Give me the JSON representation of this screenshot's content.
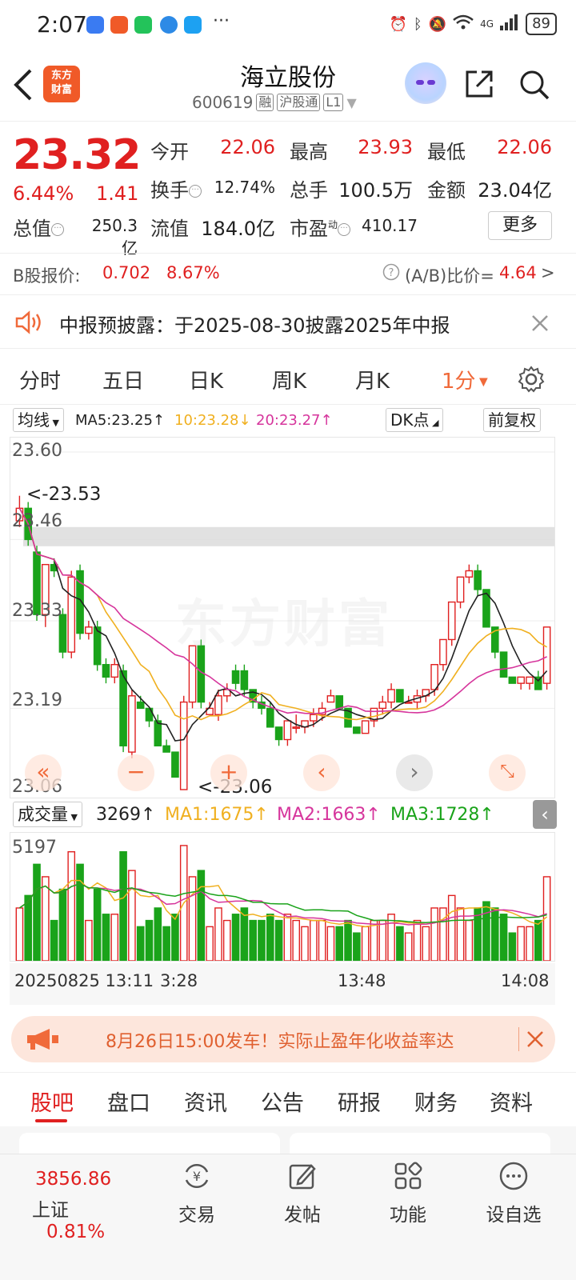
{
  "status_bar": {
    "time": "2:07",
    "more": "···",
    "network": "4G",
    "battery": "89"
  },
  "header": {
    "title": "海立股份",
    "code": "600619",
    "tag_margin": "融",
    "tag_connect": "沪股通",
    "tag_level": "L1",
    "logo_line1": "东方",
    "logo_line2": "财富"
  },
  "quote": {
    "price": "23.32",
    "change_pct": "6.44%",
    "change": "1.41",
    "open_label": "今开",
    "open": "22.06",
    "high_label": "最高",
    "high": "23.93",
    "low_label": "最低",
    "low": "22.06",
    "turnover_label": "换手",
    "turnover": "12.74%",
    "volume_label": "总手",
    "volume": "100.5万",
    "amount_label": "金额",
    "amount": "23.04亿",
    "mcap_label": "总值",
    "mcap": "250.3亿",
    "float_label": "流值",
    "float": "184.0亿",
    "pe_label": "市盈",
    "pe_sup": "动",
    "pe": "410.17",
    "more_button": "更多"
  },
  "b_share": {
    "label": "B股报价:",
    "price": "0.702",
    "pct": "8.67%",
    "ratio_label": "(A/B)比价=",
    "ratio": "4.64",
    "arrow": ">"
  },
  "notice": {
    "text": "中报预披露：于2025-08-30披露2025年中报"
  },
  "tabs": [
    "分时",
    "五日",
    "日K",
    "周K",
    "月K",
    "1分"
  ],
  "ma_legend": {
    "selector": "均线",
    "ma5": "MA5:23.25↑",
    "ma10": "10:23.28↓",
    "ma20": "20:23.27↑",
    "dk": "DK点",
    "fq": "前复权"
  },
  "chart_data": {
    "type": "candlestick",
    "interval": "1分",
    "y_ticks": [
      "23.60",
      "23.46",
      "23.33",
      "23.19",
      "23.06"
    ],
    "ylim": [
      23.06,
      23.6
    ],
    "max_annotation": "<-23.53",
    "min_annotation": "<-23.06",
    "watermark": "东方财富",
    "x_labels": [
      "20250825 13:11",
      "3:28",
      "13:48",
      "14:08"
    ],
    "candles": [
      [
        23.49,
        23.53,
        23.48,
        23.51
      ],
      [
        23.51,
        23.52,
        23.45,
        23.46
      ],
      [
        23.44,
        23.45,
        23.33,
        23.34
      ],
      [
        23.34,
        23.42,
        23.32,
        23.42
      ],
      [
        23.42,
        23.43,
        23.4,
        23.41
      ],
      [
        23.34,
        23.35,
        23.27,
        23.28
      ],
      [
        23.28,
        23.41,
        23.27,
        23.4
      ],
      [
        23.41,
        23.42,
        23.3,
        23.31
      ],
      [
        23.31,
        23.33,
        23.3,
        23.32
      ],
      [
        23.32,
        23.33,
        23.25,
        23.26
      ],
      [
        23.26,
        23.27,
        23.23,
        23.24
      ],
      [
        23.24,
        23.27,
        23.23,
        23.26
      ],
      [
        23.25,
        23.26,
        23.12,
        23.13
      ],
      [
        23.12,
        23.22,
        23.11,
        23.21
      ],
      [
        23.2,
        23.21,
        23.19,
        23.19
      ],
      [
        23.19,
        23.19,
        23.16,
        23.17
      ],
      [
        23.17,
        23.18,
        23.13,
        23.13
      ],
      [
        23.13,
        23.14,
        23.12,
        23.12
      ],
      [
        23.12,
        23.12,
        23.08,
        23.08
      ],
      [
        23.06,
        23.21,
        23.06,
        23.2
      ],
      [
        23.2,
        23.29,
        23.19,
        23.29
      ],
      [
        23.29,
        23.3,
        23.19,
        23.2
      ],
      [
        23.18,
        23.2,
        23.18,
        23.19
      ],
      [
        23.18,
        23.22,
        23.17,
        23.21
      ],
      [
        23.21,
        23.23,
        23.2,
        23.22
      ],
      [
        23.25,
        23.26,
        23.22,
        23.23
      ],
      [
        23.25,
        23.26,
        23.21,
        23.22
      ],
      [
        23.22,
        23.22,
        23.19,
        23.2
      ],
      [
        23.2,
        23.21,
        23.18,
        23.19
      ],
      [
        23.19,
        23.2,
        23.16,
        23.16
      ],
      [
        23.16,
        23.16,
        23.13,
        23.14
      ],
      [
        23.14,
        23.17,
        23.13,
        23.17
      ],
      [
        23.16,
        23.18,
        23.15,
        23.16
      ],
      [
        23.16,
        23.17,
        23.15,
        23.17
      ],
      [
        23.17,
        23.19,
        23.16,
        23.18
      ],
      [
        23.18,
        23.2,
        23.17,
        23.19
      ],
      [
        23.2,
        23.22,
        23.2,
        23.21
      ],
      [
        23.21,
        23.21,
        23.19,
        23.19
      ],
      [
        23.19,
        23.19,
        23.16,
        23.16
      ],
      [
        23.16,
        23.16,
        23.15,
        23.15
      ],
      [
        23.15,
        23.17,
        23.15,
        23.17
      ],
      [
        23.17,
        23.19,
        23.16,
        23.19
      ],
      [
        23.19,
        23.21,
        23.18,
        23.2
      ],
      [
        23.2,
        23.23,
        23.19,
        23.22
      ],
      [
        23.22,
        23.22,
        23.2,
        23.2
      ],
      [
        23.2,
        23.21,
        23.2,
        23.2
      ],
      [
        23.2,
        23.22,
        23.19,
        23.21
      ],
      [
        23.21,
        23.22,
        23.2,
        23.22
      ],
      [
        23.22,
        23.26,
        23.21,
        23.26
      ],
      [
        23.26,
        23.3,
        23.25,
        23.3
      ],
      [
        23.3,
        23.36,
        23.29,
        23.36
      ],
      [
        23.36,
        23.4,
        23.35,
        23.4
      ],
      [
        23.4,
        23.42,
        23.39,
        23.41
      ],
      [
        23.41,
        23.42,
        23.37,
        23.38
      ],
      [
        23.38,
        23.38,
        23.32,
        23.32
      ],
      [
        23.32,
        23.32,
        23.27,
        23.28
      ],
      [
        23.28,
        23.28,
        23.24,
        23.24
      ],
      [
        23.24,
        23.24,
        23.23,
        23.23
      ],
      [
        23.23,
        23.24,
        23.22,
        23.24
      ],
      [
        23.23,
        23.24,
        23.22,
        23.24
      ],
      [
        23.24,
        23.25,
        23.22,
        23.22
      ],
      [
        23.23,
        23.32,
        23.22,
        23.32
      ]
    ],
    "series": [
      {
        "name": "MA5",
        "color": "#222222"
      },
      {
        "name": "10",
        "color": "#f0b020"
      },
      {
        "name": "20",
        "color": "#d6359c"
      }
    ],
    "volume": {
      "selector": "成交量",
      "value": "3269↑",
      "ma1": "MA1:1675↑",
      "ma2": "MA2:1663↑",
      "ma3": "MA3:1728↑",
      "y_tick": "5197",
      "ylim": [
        0,
        5197
      ]
    }
  },
  "promo": {
    "text": "8月26日15:00发车！实际止盈年化收益率达"
  },
  "sub_tabs": [
    "股吧",
    "盘口",
    "资讯",
    "公告",
    "研报",
    "财务",
    "资料"
  ],
  "bottom_nav": {
    "index_value": "3856.86",
    "index_name": "上证",
    "index_pct": "0.81%",
    "items": [
      "交易",
      "发帖",
      "功能",
      "设自选"
    ]
  },
  "colors": {
    "up": "#e02020",
    "down": "#1aa31a",
    "accent": "#f06a3a"
  }
}
